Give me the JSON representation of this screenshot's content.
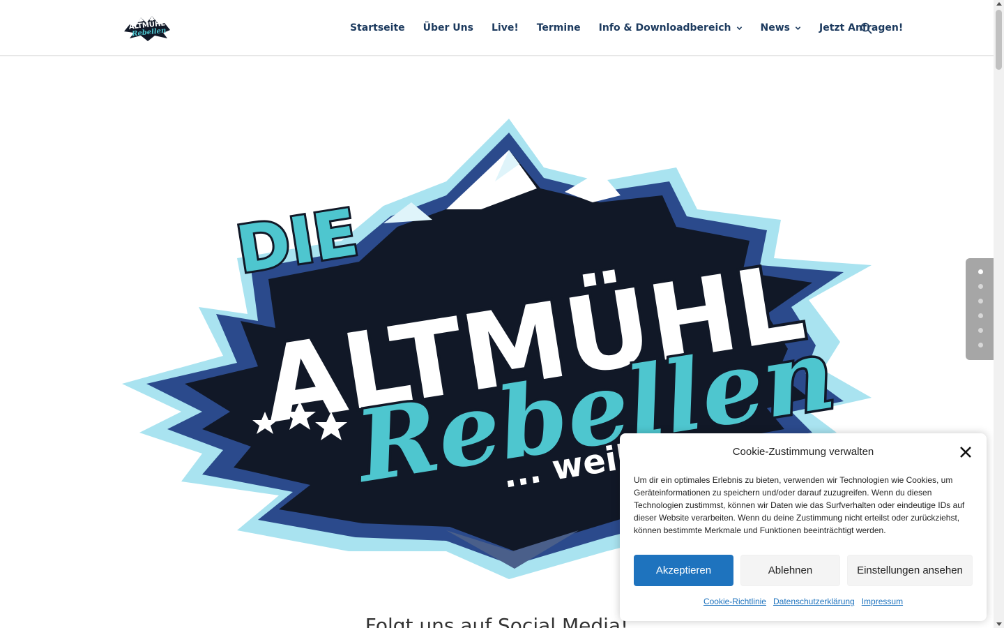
{
  "header": {
    "logo_text": "Die Altmühl Rebellen",
    "nav": [
      {
        "label": "Startseite",
        "has_dropdown": false
      },
      {
        "label": "Über Uns",
        "has_dropdown": false
      },
      {
        "label": "Live!",
        "has_dropdown": false
      },
      {
        "label": "Termine",
        "has_dropdown": false
      },
      {
        "label": "Info & Downloadbereich",
        "has_dropdown": true
      },
      {
        "label": "News",
        "has_dropdown": true
      },
      {
        "label": "Jetzt Anfragen!",
        "has_dropdown": false
      }
    ],
    "search_icon": "search-icon"
  },
  "hero": {
    "logo_line1": "DIE",
    "logo_line2": "ALTMÜHL",
    "logo_line3": "Rebellen",
    "logo_tagline": "... weil's"
  },
  "section": {
    "heading": "Folgt uns auf Social Media!"
  },
  "dot_nav": {
    "count": 6,
    "active_index": 0
  },
  "cookie": {
    "title": "Cookie-Zustimmung verwalten",
    "text": "Um dir ein optimales Erlebnis zu bieten, verwenden wir Technologien wie Cookies, um Geräteinformationen zu speichern und/oder darauf zuzugreifen. Wenn du diesen Technologien zustimmst, können wir Daten wie das Surfverhalten oder eindeutige IDs auf dieser Website verarbeiten. Wenn du deine Zustimmung nicht erteilst oder zurückziehst, können bestimmte Merkmale und Funktionen beeinträchtigt werden.",
    "accept_label": "Akzeptieren",
    "deny_label": "Ablehnen",
    "settings_label": "Einstellungen ansehen",
    "links": [
      "Cookie-Richtlinie",
      "Datenschutzerklärung",
      "Impressum"
    ]
  },
  "colors": {
    "nav_text": "#1c3a5e",
    "accent_teal": "#4ec6cf",
    "button_blue": "#1e73be",
    "logo_dark": "#111827"
  }
}
